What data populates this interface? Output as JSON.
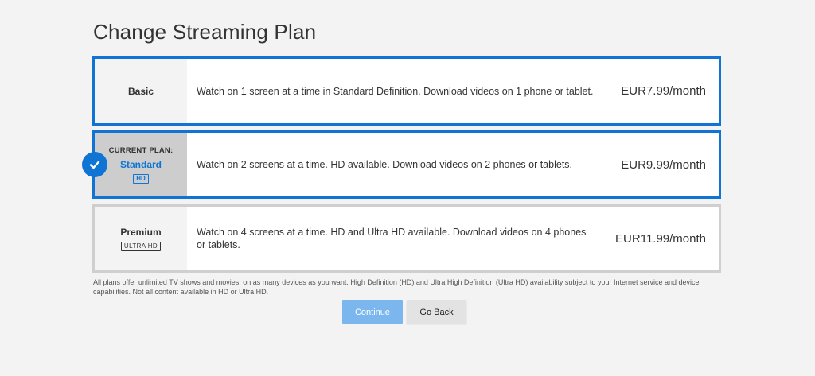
{
  "page": {
    "title": "Change Streaming Plan"
  },
  "plans": [
    {
      "name": "Basic",
      "description": "Watch on 1 screen at a time in Standard Definition. Download videos on 1 phone or tablet.",
      "price": "EUR7.99/month",
      "state": "selected"
    },
    {
      "current_caption": "CURRENT PLAN:",
      "name": "Standard",
      "badge": "HD",
      "description": "Watch on 2 screens at a time. HD available. Download videos on 2 phones or tablets.",
      "price": "EUR9.99/month",
      "state": "current"
    },
    {
      "name": "Premium",
      "badge": "ULTRA HD",
      "description": "Watch on 4 screens at a time. HD and Ultra HD available. Download videos on 4 phones or tablets.",
      "price": "EUR11.99/month",
      "state": "unselected"
    }
  ],
  "disclaimer": "All plans offer unlimited TV shows and movies, on as many devices as you want. High Definition (HD) and Ultra High Definition (Ultra HD) availability subject to your Internet service and device capabilities. Not all content available in HD or Ultra HD.",
  "buttons": {
    "continue": "Continue",
    "go_back": "Go Back"
  },
  "colors": {
    "accent": "#0f74d4",
    "continue_disabled": "#7bb7ee",
    "background": "#f3f3f3"
  },
  "icons": {
    "current_plan_marker": "checkmark-icon"
  }
}
